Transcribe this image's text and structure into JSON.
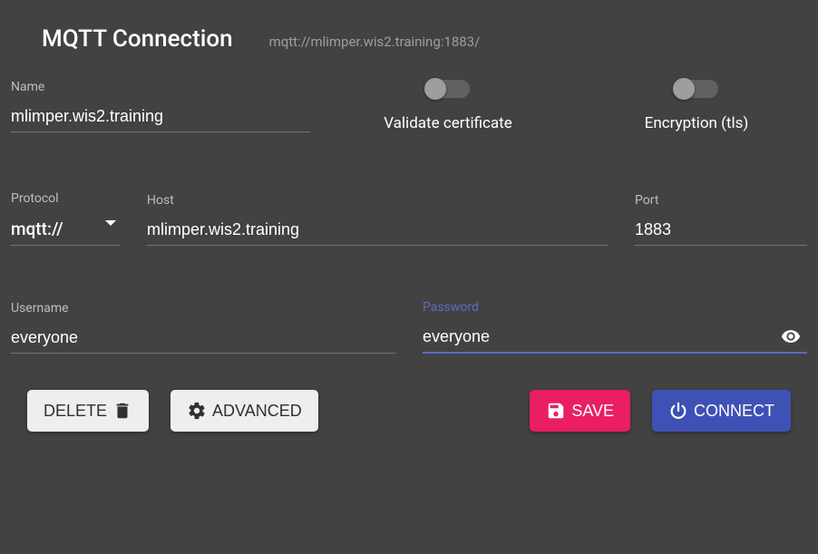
{
  "header": {
    "title": "MQTT Connection",
    "subtitle": "mqtt://mlimper.wis2.training:1883/"
  },
  "fields": {
    "name": {
      "label": "Name",
      "value": "mlimper.wis2.training"
    },
    "protocol": {
      "label": "Protocol",
      "value": "mqtt://"
    },
    "host": {
      "label": "Host",
      "value": "mlimper.wis2.training"
    },
    "port": {
      "label": "Port",
      "value": "1883"
    },
    "username": {
      "label": "Username",
      "value": "everyone"
    },
    "password": {
      "label": "Password",
      "value": "everyone"
    }
  },
  "toggles": {
    "validate_cert": {
      "label": "Validate certificate",
      "on": false
    },
    "encryption": {
      "label": "Encryption (tls)",
      "on": false
    }
  },
  "buttons": {
    "delete": "DELETE",
    "advanced": "ADVANCED",
    "save": "SAVE",
    "connect": "CONNECT"
  },
  "colors": {
    "bg": "#424242",
    "accent": "#3f51b5",
    "accent2": "#e91e63",
    "focus": "#5c6bc0"
  }
}
